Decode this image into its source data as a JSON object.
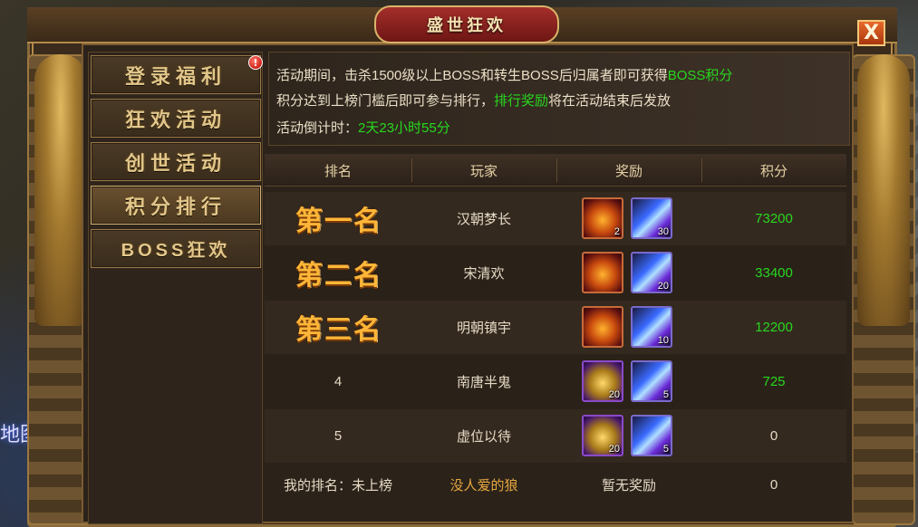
{
  "window": {
    "title": "盛世狂欢",
    "close_label": "X"
  },
  "world": {
    "partial_text": "地图"
  },
  "sidebar": {
    "badge": "!",
    "items": [
      {
        "label": "登录福利"
      },
      {
        "label": "狂欢活动"
      },
      {
        "label": "创世活动"
      },
      {
        "label": "积分排行",
        "active": true
      },
      {
        "label": "BOSS狂欢"
      }
    ]
  },
  "info": {
    "line1_prefix": "活动期间，击杀1500级以上BOSS和转生BOSS后归属者即可获得",
    "line1_highlight": "BOSS积分",
    "line2_prefix": "积分达到上榜门槛后即可参与排行，",
    "line2_highlight": "排行奖励",
    "line2_suffix": "将在活动结束后发放",
    "line3_prefix": "活动倒计时：",
    "line3_highlight": "2天23小时55分"
  },
  "table": {
    "headers": [
      "排名",
      "玩家",
      "奖励",
      "积分"
    ],
    "rows": [
      {
        "rank": "第一名",
        "player": "汉朝梦长",
        "reward1_type": "gourd",
        "reward1_count": "2",
        "reward2_type": "crystal",
        "reward2_count": "30",
        "score": "73200"
      },
      {
        "rank": "第二名",
        "player": "宋清欢",
        "reward1_type": "gourd",
        "reward1_count": "",
        "reward2_type": "crystal",
        "reward2_count": "20",
        "score": "33400"
      },
      {
        "rank": "第三名",
        "player": "明朝镇宇",
        "reward1_type": "gourd",
        "reward1_count": "",
        "reward2_type": "crystal",
        "reward2_count": "10",
        "score": "12200"
      },
      {
        "rank": "4",
        "player": "南唐半鬼",
        "reward1_type": "chest",
        "reward1_count": "20",
        "reward2_type": "crystal",
        "reward2_count": "5",
        "score": "725"
      },
      {
        "rank": "5",
        "player": "虚位以待",
        "reward1_type": "chest",
        "reward1_count": "20",
        "reward2_type": "crystal",
        "reward2_count": "5",
        "score": "0"
      }
    ]
  },
  "my_rank": {
    "label": "我的排名：未上榜",
    "player": "没人爱的狼",
    "reward": "暂无奖励",
    "score": "0"
  },
  "colors": {
    "highlight_green": "#27d81e",
    "title_red": "#a42e2a",
    "rank_gold": "#ffb638"
  }
}
